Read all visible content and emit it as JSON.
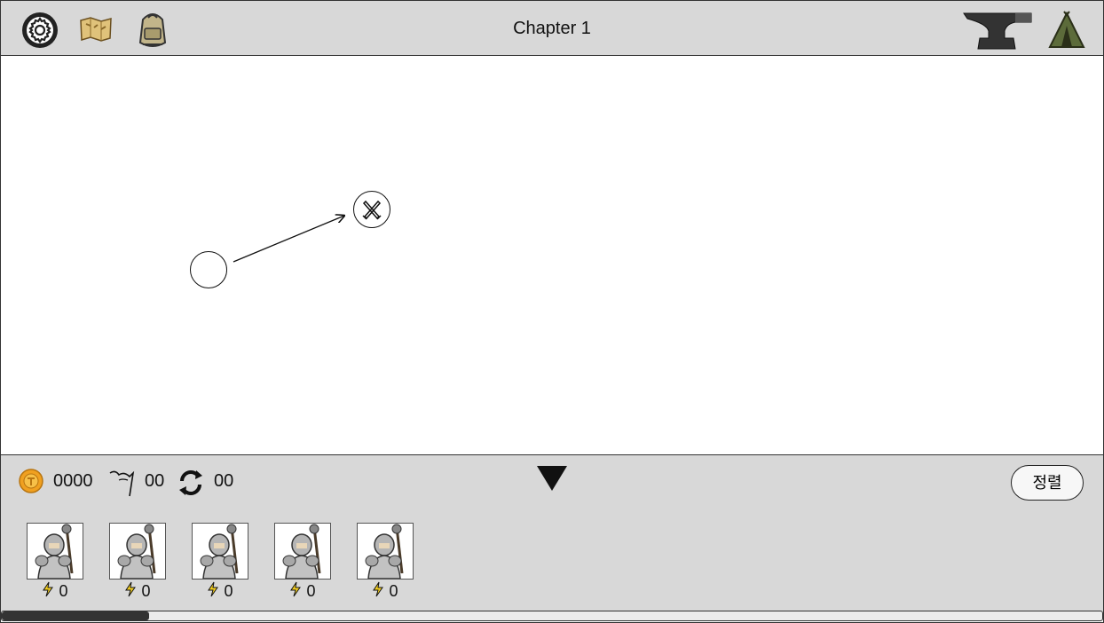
{
  "header": {
    "title": "Chapter 1",
    "icons": [
      "settings-gear-icon",
      "map-scroll-icon",
      "backpack-icon",
      "anvil-icon",
      "tent-icon"
    ]
  },
  "map": {
    "nodes": [
      {
        "name": "start-node",
        "icon": "circle"
      },
      {
        "name": "battle-node",
        "icon": "crossed-swords-icon"
      }
    ]
  },
  "status": {
    "gold": "0000",
    "flags": "00",
    "refresh": "00",
    "sort_label": "정렬",
    "accent_gold": "#f0a020"
  },
  "units": [
    {
      "energy": "0"
    },
    {
      "energy": "0"
    },
    {
      "energy": "0"
    },
    {
      "energy": "0"
    },
    {
      "energy": "0"
    }
  ],
  "scroll": {
    "position": 0
  }
}
